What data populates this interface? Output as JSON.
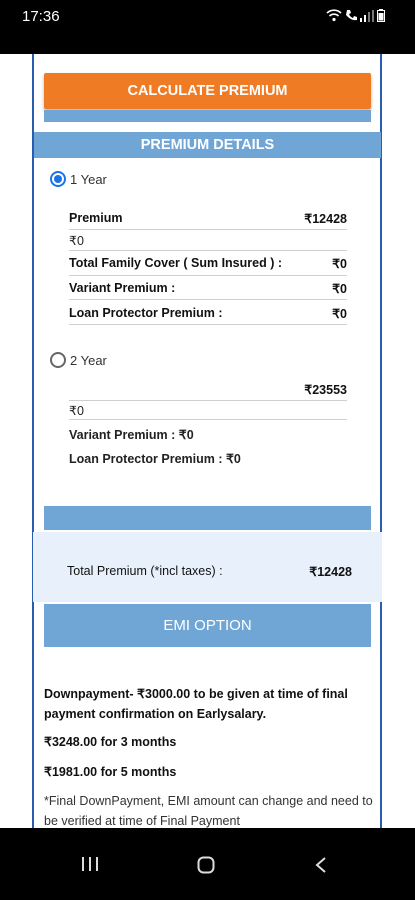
{
  "status": {
    "time": "17:36"
  },
  "header": {
    "calculate_label": "CALCULATE PREMIUM"
  },
  "premium_details": {
    "title": "PREMIUM DETAILS",
    "plan1": {
      "label": "1 Year",
      "selected": true,
      "premium_label": "Premium",
      "premium_value": "₹12428",
      "secondary_value": "₹0",
      "family_cover_label": "Total Family Cover ( Sum Insured ) :",
      "family_cover_value": "₹0",
      "variant_label": "Variant Premium :",
      "variant_value": "₹0",
      "loan_label": "Loan Protector Premium :",
      "loan_value": "₹0"
    },
    "plan2": {
      "label": "2 Year",
      "selected": false,
      "premium_value": "₹23553",
      "secondary_value": "₹0",
      "variant_text": "Variant Premium : ₹0",
      "loan_text": "Loan Protector Premium : ₹0"
    }
  },
  "total": {
    "label": "Total Premium (*incl taxes) :",
    "value": "₹12428"
  },
  "emi": {
    "title": "EMI OPTION",
    "downpayment": "Downpayment- ₹3000.00 to be given at time of final payment confirmation on Earlysalary.",
    "option_3": "₹3248.00 for 3 months",
    "option_5": "₹1981.00 for 5 months",
    "note": "*Final DownPayment, EMI amount can change and need to be verified at time of Final Payment"
  },
  "colors": {
    "accent_orange": "#ef7b25",
    "section_blue": "#6fa6d6",
    "radio_blue": "#1a73e8"
  }
}
